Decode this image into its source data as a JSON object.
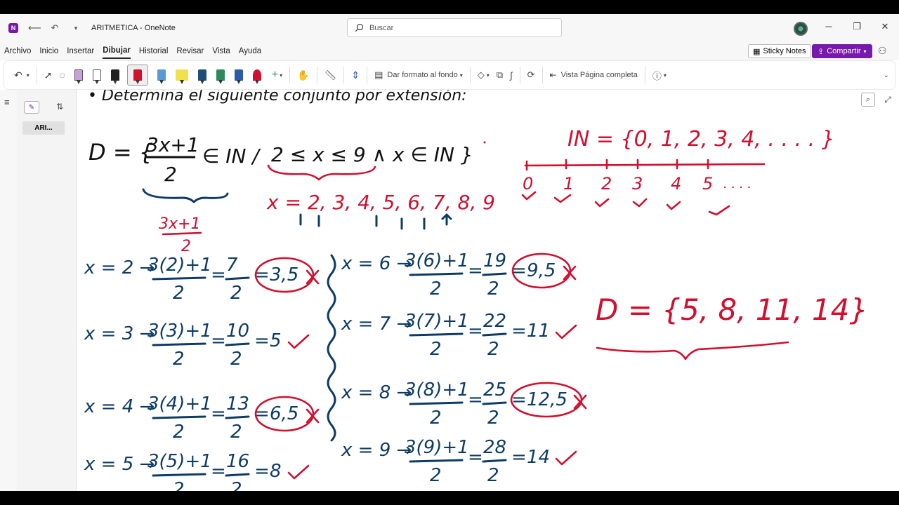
{
  "titlebar": {
    "app_badge": "N",
    "title": "ARITMETICA  -  OneNote",
    "search_placeholder": "Buscar"
  },
  "menu": {
    "items": [
      "Archivo",
      "Inicio",
      "Insertar",
      "Dibujar",
      "Historial",
      "Revisar",
      "Vista",
      "Ayuda"
    ],
    "active": "Dibujar",
    "sticky_notes": "Sticky Notes",
    "share": "Compartir"
  },
  "ribbon": {
    "background_format": "Dar formato al fondo",
    "full_page_view": "Vista Página completa",
    "pen_colors": [
      "#c9a0dc",
      "#222222",
      "#222222",
      "#d10f2f",
      "#5b9bd5",
      "#f2e14c",
      "#1f4e79",
      "#2e8b57",
      "#2a5caa",
      "#d10f2f"
    ]
  },
  "nav": {
    "page_label": "ARI..."
  },
  "canvas": {
    "top_text": "• Determina el siguiente conjunto por extensión:",
    "set_definition": {
      "lhs": "D = {",
      "numerator": "3x+1",
      "denominator": "2",
      "membership": "∈ IN /",
      "condition": "2 ≤ x ≤ 9 ∧ x ∈ IN }"
    },
    "naturals": "IN = {0, 1, 2, 3, 4, . . . . }",
    "number_line_labels": [
      "0",
      "1",
      "2",
      "3",
      "4",
      "5",
      ". . . ."
    ],
    "x_values": "x = 2, 3, 4, 5, 6, 7, 8, 9",
    "expr_num": "3x+1",
    "expr_den": "2",
    "left_calcs": [
      {
        "x": "x = 2 →",
        "expr": "3(2)+1",
        "eq1": "7",
        "res": "3,5",
        "ok": false
      },
      {
        "x": "x = 3 →",
        "expr": "3(3)+1",
        "eq1": "10",
        "res": "5",
        "ok": true
      },
      {
        "x": "x = 4 →",
        "expr": "3(4)+1",
        "eq1": "13",
        "res": "6,5",
        "ok": false
      },
      {
        "x": "x = 5 →",
        "expr": "3(5)+1",
        "eq1": "16",
        "res": "8",
        "ok": true
      }
    ],
    "right_calcs": [
      {
        "x": "x = 6 →",
        "expr": "3(6)+1",
        "eq1": "19",
        "res": "9,5",
        "ok": false
      },
      {
        "x": "x = 7 →",
        "expr": "3(7)+1",
        "eq1": "22",
        "res": "11",
        "ok": true
      },
      {
        "x": "x = 8 →",
        "expr": "3(8)+1",
        "eq1": "25",
        "res": "12,5",
        "ok": false
      },
      {
        "x": "x = 9 →",
        "expr": "3(9)+1",
        "eq1": "28",
        "res": "14",
        "ok": true
      }
    ],
    "answer": "D = {5, 8, 11, 14}"
  }
}
